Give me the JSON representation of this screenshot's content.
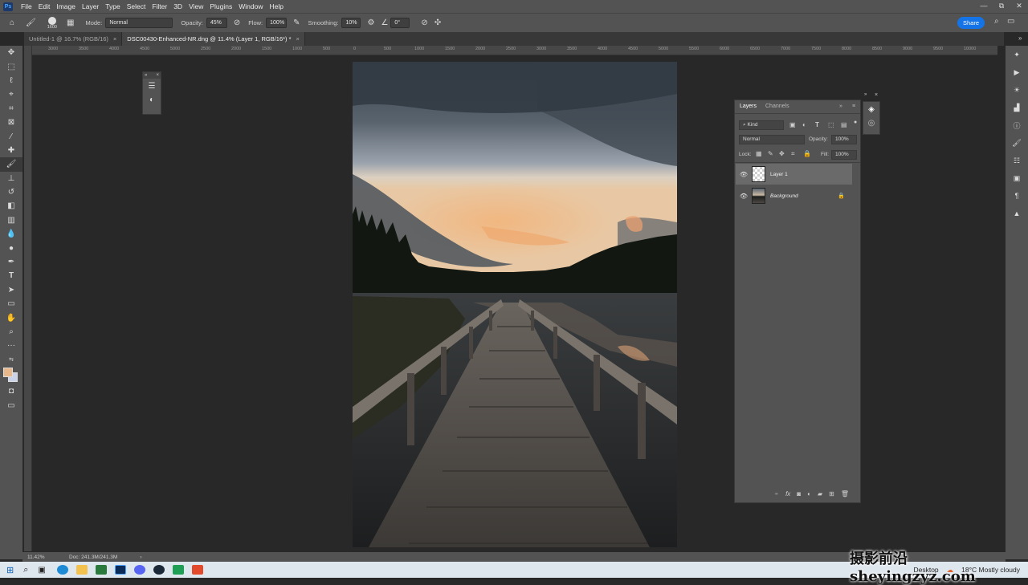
{
  "menubar": {
    "logo": "Ps",
    "items": [
      "File",
      "Edit",
      "Image",
      "Layer",
      "Type",
      "Select",
      "Filter",
      "3D",
      "View",
      "Plugins",
      "Window",
      "Help"
    ],
    "window_controls": [
      "—",
      "⧉",
      "✕"
    ]
  },
  "options": {
    "brush_size": "1600",
    "mode_label": "Mode:",
    "mode_value": "Normal",
    "opacity_label": "Opacity:",
    "opacity_value": "45%",
    "flow_label": "Flow:",
    "flow_value": "100%",
    "smoothing_label": "Smoothing:",
    "smoothing_value": "10%",
    "angle_value": "0°",
    "share_label": "Share"
  },
  "tabs": [
    {
      "label": "Untitled-1 @ 16.7% (RGB/16)",
      "close": "×"
    },
    {
      "label": "DSC00430-Enhanced-NR.dng @ 11.4% (Layer 1, RGB/16*) *",
      "close": "×"
    }
  ],
  "ruler": {
    "ticks": [
      "3000",
      "3500",
      "4000",
      "4500",
      "5000",
      "2500",
      "2000",
      "1500",
      "1000",
      "500",
      "0",
      "500",
      "1000",
      "1500",
      "2000",
      "2500",
      "3000",
      "3500",
      "4000",
      "4500",
      "5000",
      "5500",
      "6000",
      "6500",
      "7000",
      "7500",
      "8000",
      "8500",
      "9000",
      "9500",
      "10000"
    ]
  },
  "layers_panel": {
    "tab_layers": "Layers",
    "tab_channels": "Channels",
    "filter_kind": "Kind",
    "blend_mode": "Normal",
    "opacity_label": "Opacity:",
    "opacity_value": "100%",
    "lock_label": "Lock:",
    "fill_label": "Fill:",
    "fill_value": "100%",
    "layers": [
      {
        "name": "Layer 1",
        "selected": true
      },
      {
        "name": "Background",
        "selected": false
      }
    ]
  },
  "status": {
    "zoom": "11.42%",
    "doc": "Doc: 241.3M/241.3M",
    "arrow": "›"
  },
  "taskbar": {
    "desktop_label": "Desktop",
    "weather": "18°C  Mostly cloudy"
  },
  "watermark": "摄影前沿 sheyingzyz.com",
  "colors": {
    "accent": "#1473e6",
    "foreground_swatch": "#e8b88a",
    "background_swatch": "#c9d3ec"
  }
}
